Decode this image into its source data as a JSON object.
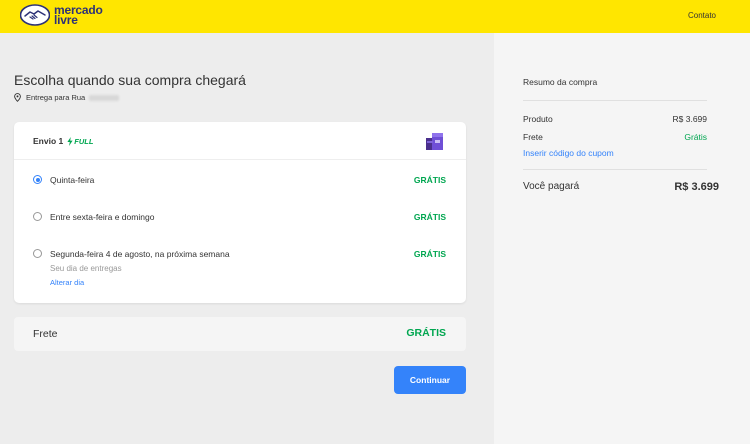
{
  "header": {
    "logo_line1": "mercado",
    "logo_line2": "livre",
    "contact_link": "Contato",
    "colors": {
      "brand_yellow": "#ffe600",
      "brand_navy": "#2d3277"
    }
  },
  "main": {
    "title": "Escolha quando sua compra chegará",
    "delivery_text": "Entrega para Rua",
    "shipment": {
      "title": "Envio 1",
      "badge": "FULL",
      "badge_icon": "lightning-icon",
      "package_icon": "package-icon",
      "options": [
        {
          "label": "Quinta-feira",
          "price": "GRÁTIS",
          "selected": true
        },
        {
          "label": "Entre sexta-feira e domingo",
          "price": "GRÁTIS",
          "selected": false
        },
        {
          "label": "Segunda-feira 4 de agosto, na próxima semana",
          "price": "GRÁTIS",
          "selected": false,
          "subtext": "Seu dia de entregas",
          "link": "Alterar dia"
        }
      ]
    },
    "frete": {
      "label": "Frete",
      "value": "GRÁTIS"
    },
    "continue_button": "Continuar",
    "colors": {
      "accent_blue": "#3483fa",
      "free_green": "#00a650"
    }
  },
  "summary": {
    "title": "Resumo da compra",
    "product_label": "Produto",
    "product_value": "R$ 3.699",
    "shipping_label": "Frete",
    "shipping_value": "Grátis",
    "coupon_link": "Inserir código do cupom",
    "total_label": "Você pagará",
    "total_value": "R$ 3.699"
  }
}
